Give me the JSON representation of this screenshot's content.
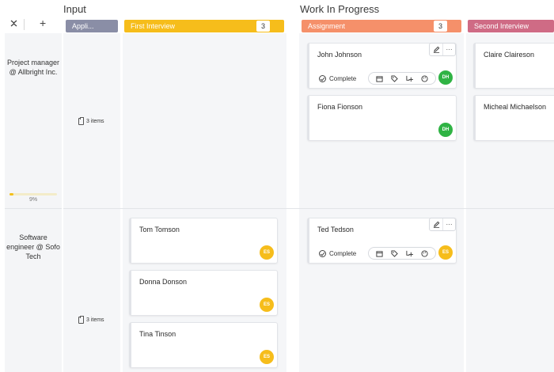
{
  "colors": {
    "applied": "#8a8ea6",
    "first_interview": "#f6bd1b",
    "assignment": "#f5906a",
    "second_interview": "#cf6b85",
    "avatar_green": "#2fb344",
    "avatar_yellow": "#f6bd1b",
    "progress": "#f3c01c"
  },
  "sections": {
    "input": "Input",
    "work_in_progress": "Work In Progress"
  },
  "controls": {
    "collapse_icon": "collapse-arrows-icon",
    "add_symbol": "+"
  },
  "columns": [
    {
      "label": "Appli...",
      "count": ""
    },
    {
      "label": "First Interview",
      "count": "3"
    },
    {
      "label": "Assignment",
      "count": "3"
    },
    {
      "label": "Second Interview",
      "count": ""
    }
  ],
  "rows": [
    {
      "label": "Project manager @ Allbright Inc.",
      "progress_text": "9%",
      "progress_value": 0.09,
      "items_count": "3 items"
    },
    {
      "label": "Software engineer @ Sofo Tech",
      "items_count": "3 items"
    }
  ],
  "cards": {
    "john": {
      "name": "John Johnson",
      "status": "Complete",
      "avatar": "DH"
    },
    "fiona": {
      "name": "Fiona Fionson",
      "avatar": "DH"
    },
    "claire": {
      "name": "Claire Claireson"
    },
    "micheal": {
      "name": "Micheal Michaelson"
    },
    "tom": {
      "name": "Tom Tomson",
      "avatar": "ES"
    },
    "donna": {
      "name": "Donna Donson",
      "avatar": "ES"
    },
    "tina": {
      "name": "Tina Tinson",
      "avatar": "ES"
    },
    "ted": {
      "name": "Ted Tedson",
      "status": "Complete",
      "avatar": "ES"
    }
  },
  "card_tools": {
    "edit_icon": "pencil-icon",
    "more_label": "···"
  },
  "card_actions": [
    "calendar-icon",
    "tag-icon",
    "assign-user-icon",
    "palette-icon"
  ]
}
